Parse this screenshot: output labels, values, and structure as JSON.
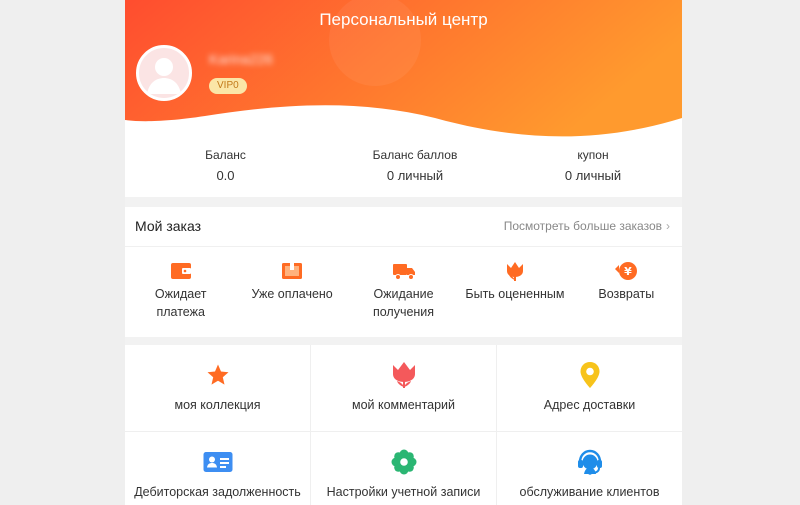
{
  "header": {
    "title": "Персональный центр",
    "username": "Karina226",
    "vip_label": "VIP0"
  },
  "stats": [
    {
      "label": "Баланс",
      "value": "0.0"
    },
    {
      "label": "Баланс баллов",
      "value": "0 личный"
    },
    {
      "label": "купон",
      "value": "0 личный"
    }
  ],
  "orders": {
    "title": "Мой заказ",
    "more_label": "Посмотреть больше заказов",
    "items": [
      {
        "label": "Ожидает платежа",
        "icon": "wallet-icon"
      },
      {
        "label": "Уже оплачено",
        "icon": "paid-box-icon"
      },
      {
        "label": "Ожидание получения",
        "icon": "truck-icon"
      },
      {
        "label": "Быть оцененным",
        "icon": "tulip-icon"
      },
      {
        "label": "Возвраты",
        "icon": "yen-return-icon"
      }
    ]
  },
  "grid": [
    {
      "label": "моя коллекция",
      "icon": "star-icon"
    },
    {
      "label": "мой комментарий",
      "icon": "tulip-icon"
    },
    {
      "label": "Адрес доставки",
      "icon": "location-pin-icon"
    },
    {
      "label": "Дебиторская задолженность",
      "icon": "id-card-icon"
    },
    {
      "label": "Настройки учетной записи",
      "icon": "gear-icon"
    },
    {
      "label": "обслуживание клиентов",
      "icon": "headset-icon"
    }
  ],
  "colors": {
    "accent": "#ff6b23",
    "gradient_start": "#ff4d2f",
    "gradient_end": "#ff9a2e",
    "pin": "#f7c31b",
    "gear": "#2bb673",
    "card": "#3d8ef2",
    "headset": "#1f8de9"
  }
}
